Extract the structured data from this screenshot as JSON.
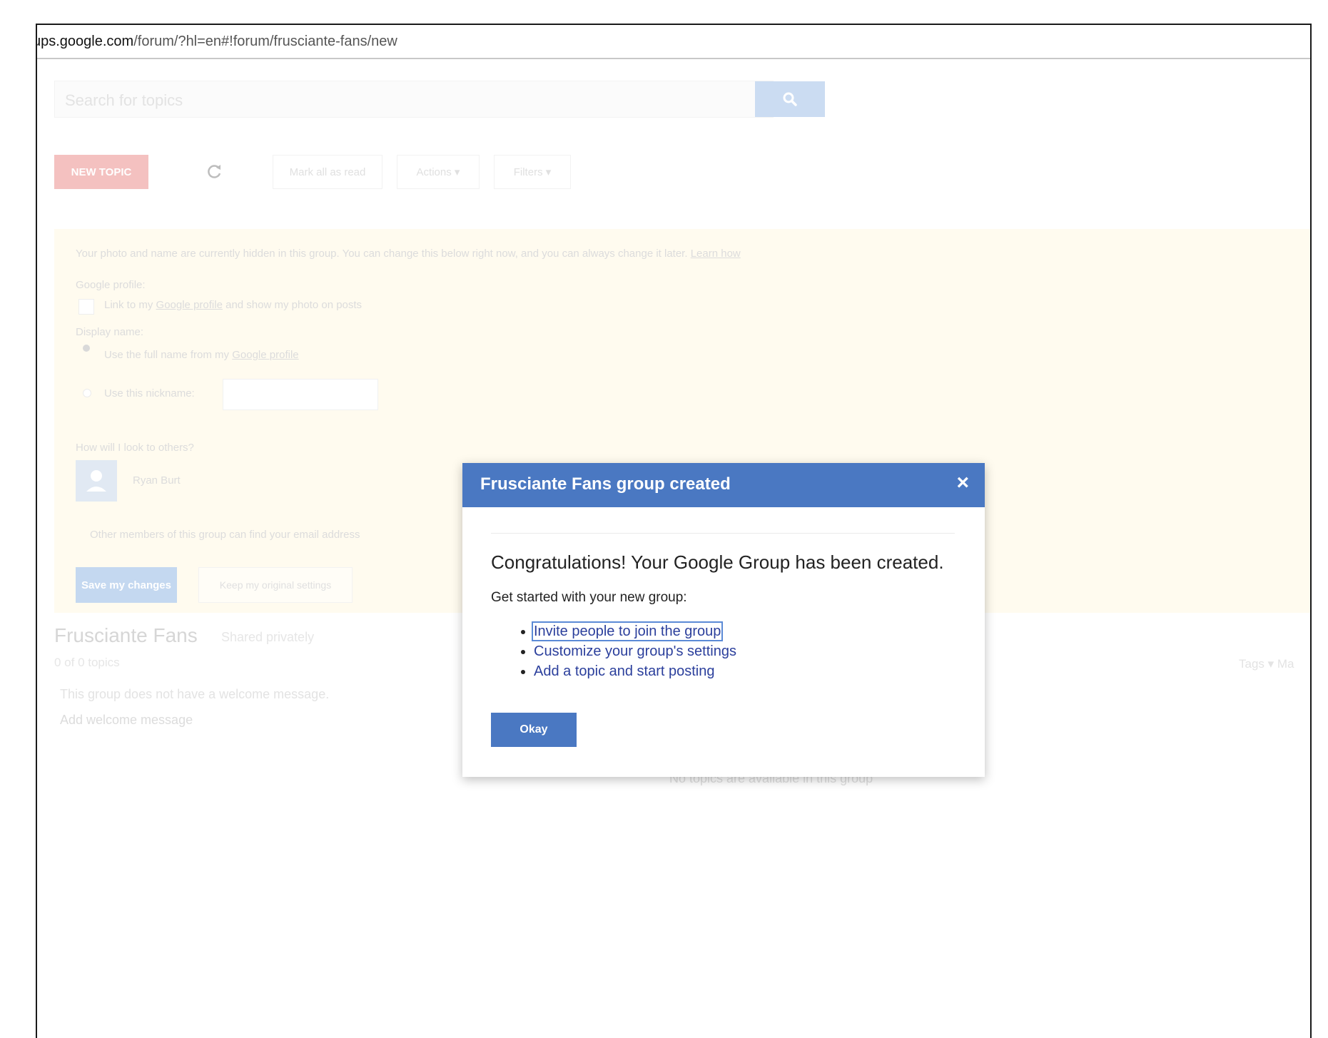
{
  "address_bar": {
    "host": "ups.google.com",
    "path": "/forum/?hl=en#!forum/frusciante-fans/new"
  },
  "search": {
    "placeholder": "Search for topics"
  },
  "toolbar": {
    "new_topic": "NEW TOPIC",
    "mark_all_read": "Mark all as read",
    "actions": "Actions ▾",
    "filters": "Filters ▾"
  },
  "notice": {
    "message": "Your photo and name are currently hidden in this group. You can change this below right now, and you can always change it later.",
    "learn_how": "Learn how",
    "google_profile_label": "Google profile:",
    "link_profile_prefix": "Link to my ",
    "link_profile_link": "Google profile",
    "link_profile_suffix": " and show my photo on posts",
    "display_name_label": "Display name:",
    "use_full_name_prefix": "Use the full name from my ",
    "use_full_name_link": "Google profile",
    "use_nickname": "Use this nickname:",
    "how_look": "How will I look to others?",
    "user_name": "Ryan Burt",
    "email_notice": "Other members of this group can find your email address",
    "save_button": "Save my changes",
    "revert_button": "Keep my original settings"
  },
  "group": {
    "title": "Frusciante Fans",
    "shared": "Shared privately",
    "topic_count": "0 of 0 topics",
    "tags": "Tags ▾  Ma",
    "no_welcome": "This group does not have a welcome message.",
    "add_welcome": "Add welcome message",
    "no_topics": "No topics are available in this group"
  },
  "modal": {
    "title": "Frusciante Fans group created",
    "close": "×",
    "heading": "Congratulations! Your Google Group has been created.",
    "subheading": "Get started with your new group:",
    "links": [
      "Invite people to join the group",
      "Customize your group's settings",
      "Add a topic and start posting"
    ],
    "okay": "Okay"
  },
  "colors": {
    "modal_header": "#4a78c2",
    "link": "#2b3f9c",
    "notice_bg": "#fffbef",
    "new_topic_faded": "#f4c1c0"
  }
}
